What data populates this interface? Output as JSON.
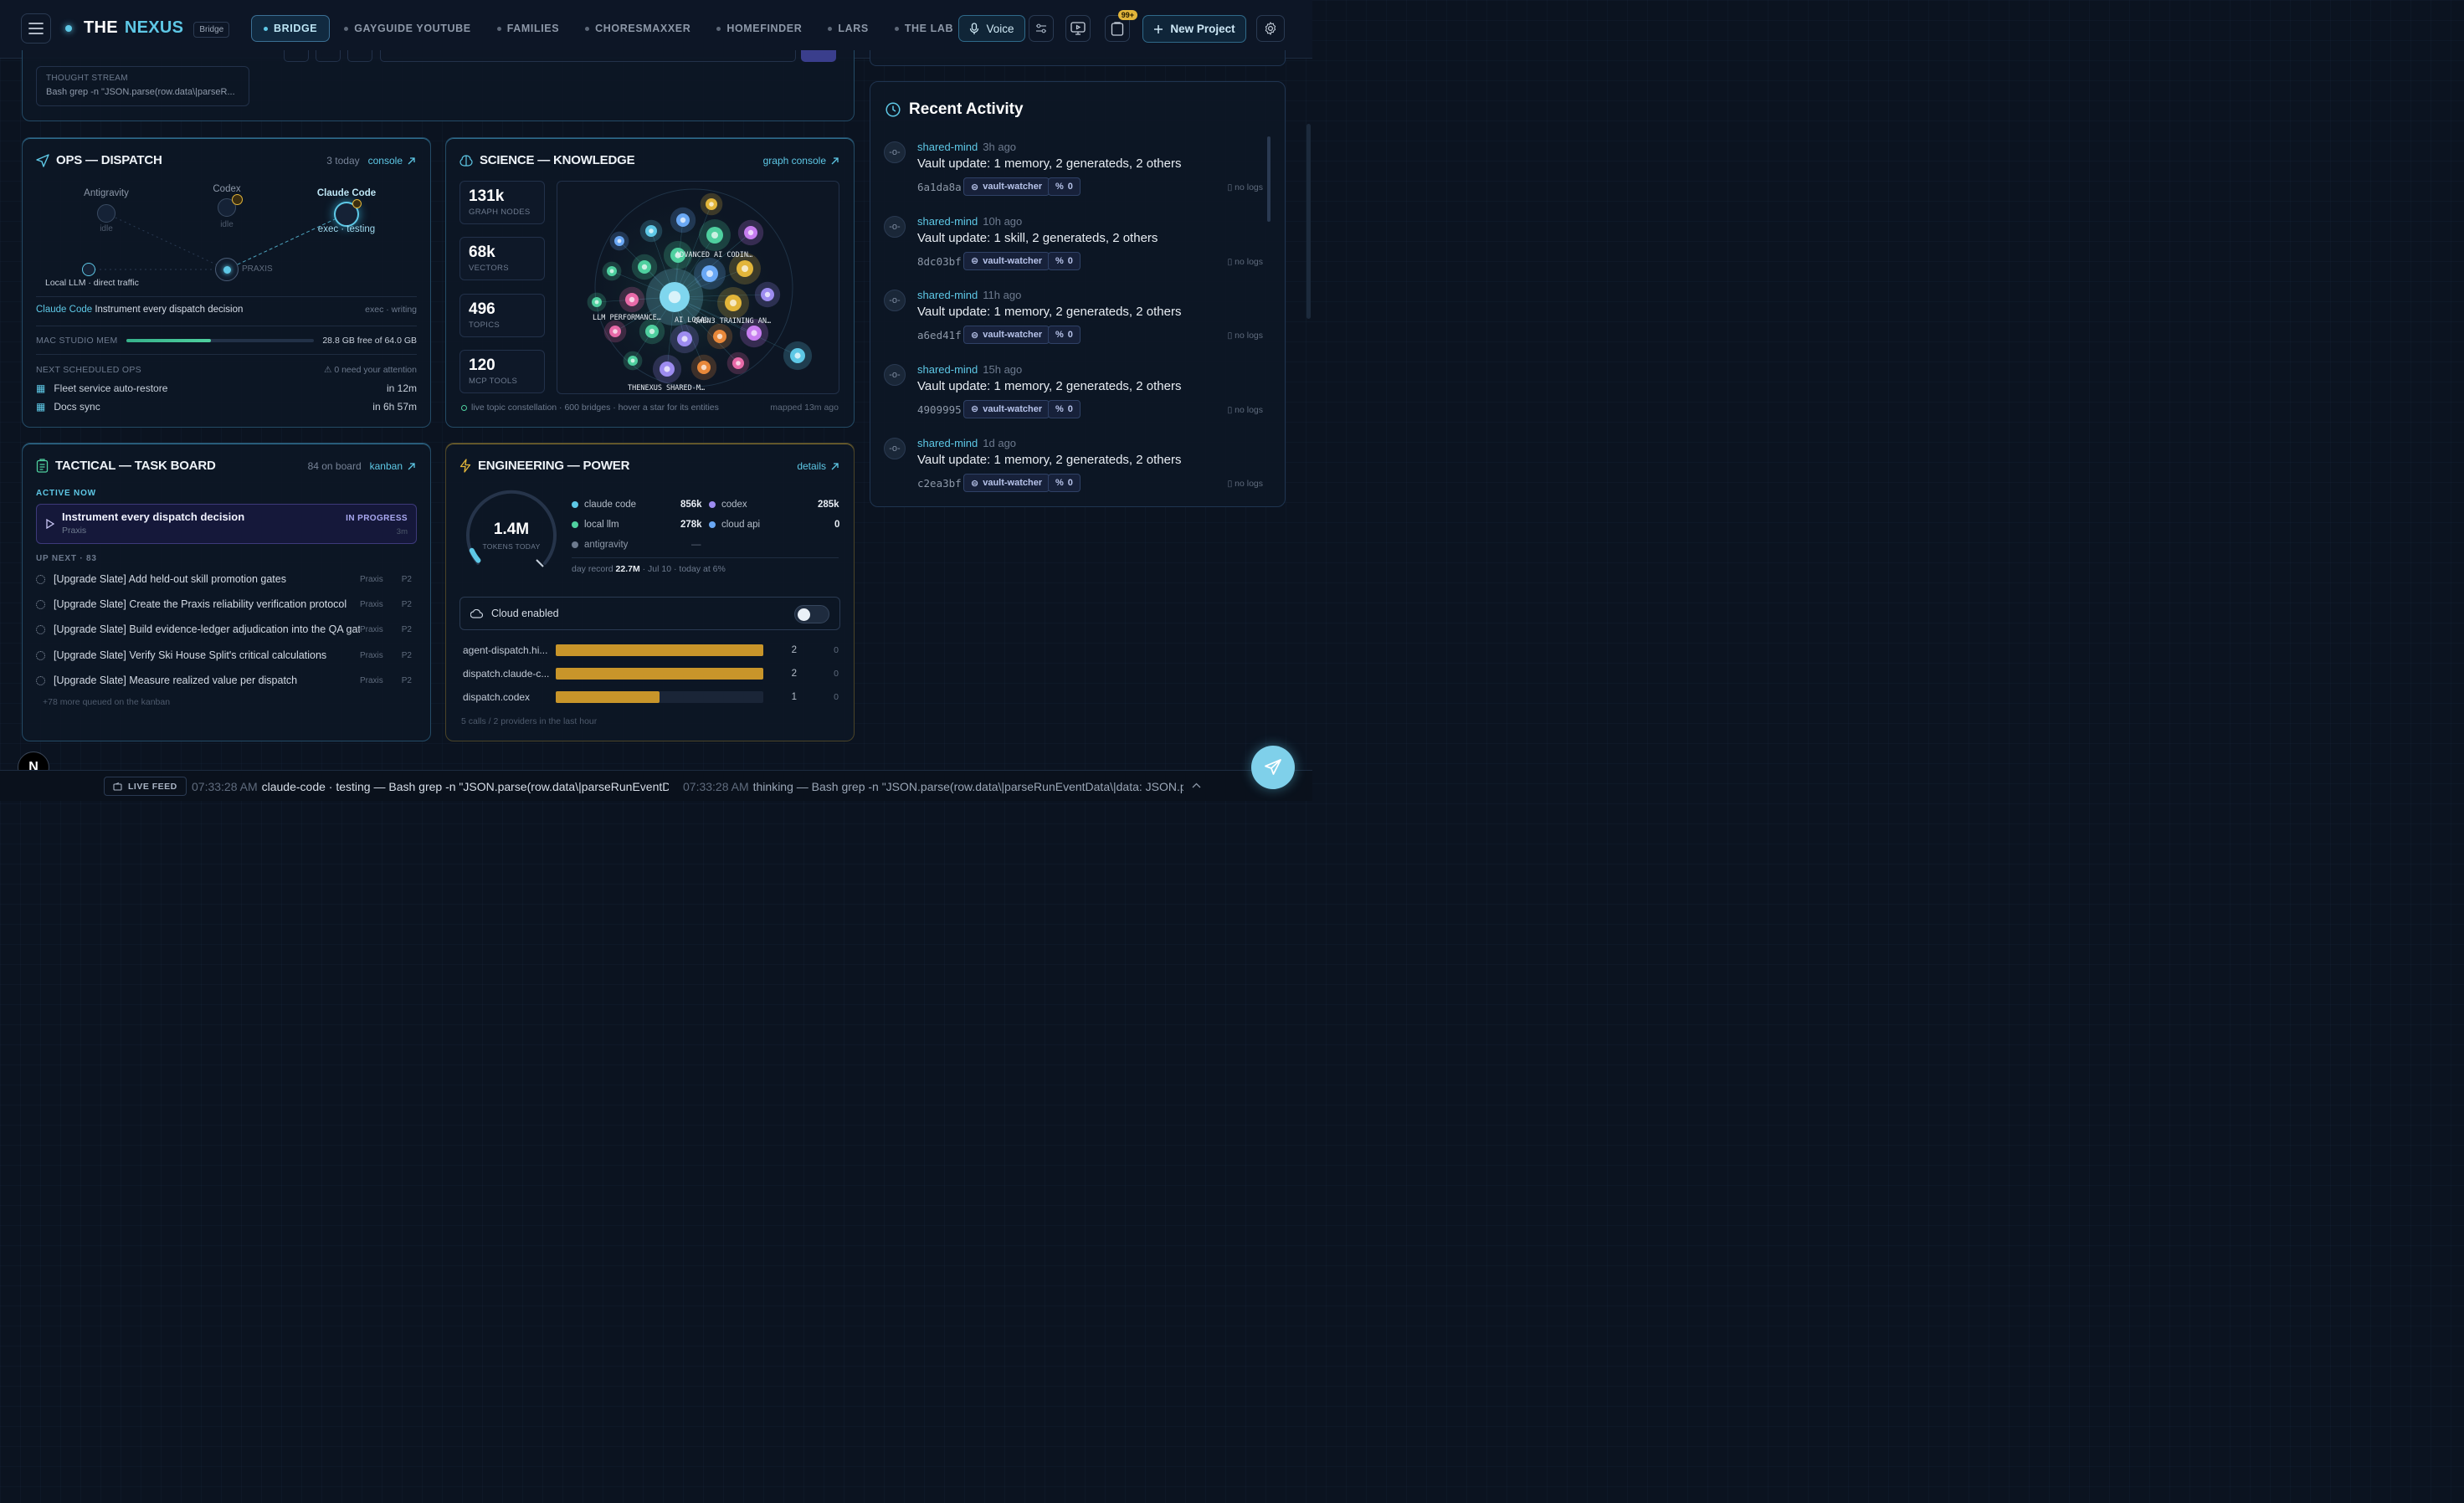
{
  "app": {
    "name_a": "THE",
    "name_b": "NEXUS",
    "tag": "Bridge"
  },
  "nav": {
    "tabs": [
      "BRIDGE",
      "GAYGUIDE YOUTUBE",
      "FAMILIES",
      "CHORESMAXXER",
      "HOMEFINDER",
      "LARS",
      "THE LAB"
    ]
  },
  "toolbar": {
    "voice": "Voice",
    "notifications_badge": "99+",
    "new_project": "New Project"
  },
  "thought_stream": {
    "label": "THOUGHT STREAM",
    "value": "Bash grep -n \"JSON.parse(row.data\\|parseR..."
  },
  "ops": {
    "title": "OPS — DISPATCH",
    "count": "3 today",
    "link": "console",
    "agents": {
      "antigravity": "Antigravity",
      "antigravity_status": "idle",
      "codex": "Codex",
      "codex_status": "idle",
      "claude": "Claude Code",
      "claude_status": "exec · testing",
      "praxis": "PRAXIS",
      "local": "Local LLM · direct traffic"
    },
    "current_agent": "Claude Code",
    "current_task": "Instrument every dispatch decision",
    "current_state": "exec · writing",
    "mem_label": "MAC STUDIO MEM",
    "mem_value": "28.8 GB free of 64.0 GB",
    "mem_used_fraction": 0.45,
    "scheduled_label": "NEXT SCHEDULED OPS",
    "attention": "0 need your attention",
    "scheduled": [
      {
        "name": "Fleet service auto-restore",
        "when": "in 12m"
      },
      {
        "name": "Docs sync",
        "when": "in 6h 57m"
      }
    ]
  },
  "science": {
    "title": "SCIENCE — KNOWLEDGE",
    "link": "graph console",
    "stats": [
      {
        "n": "131k",
        "l": "GRAPH NODES"
      },
      {
        "n": "68k",
        "l": "VECTORS"
      },
      {
        "n": "496",
        "l": "TOPICS"
      },
      {
        "n": "120",
        "l": "MCP TOOLS"
      }
    ],
    "graph_labels": [
      "ADVANCED AI CODIN…",
      "LLM PERFORMANCE…",
      "AI LOCAL",
      "QWEN3 TRAINING AN…",
      "THENEXUS SHARED-M…"
    ],
    "footer": "live topic constellation · 600 bridges · hover a star for its entities",
    "mapped": "mapped 13m ago"
  },
  "tactical": {
    "title": "TACTICAL — TASK BOARD",
    "count": "84 on board",
    "link": "kanban",
    "active_label": "ACTIVE NOW",
    "active": {
      "title": "Instrument every dispatch decision",
      "owner": "Praxis",
      "status": "IN PROGRESS",
      "age": "3m"
    },
    "next_label": "UP NEXT · 83",
    "tasks": [
      {
        "title": "[Upgrade Slate] Add held-out skill promotion gates",
        "owner": "Praxis",
        "p": "P2"
      },
      {
        "title": "[Upgrade Slate] Create the Praxis reliability verification protocol",
        "owner": "Praxis",
        "p": "P2"
      },
      {
        "title": "[Upgrade Slate] Build evidence-ledger adjudication into the QA gate",
        "owner": "Praxis",
        "p": "P2"
      },
      {
        "title": "[Upgrade Slate] Verify Ski House Split's critical calculations",
        "owner": "Praxis",
        "p": "P2"
      },
      {
        "title": "[Upgrade Slate] Measure realized value per dispatch",
        "owner": "Praxis",
        "p": "P2"
      }
    ],
    "more": "+78 more queued on the kanban"
  },
  "engineering": {
    "title": "ENGINEERING — POWER",
    "link": "details",
    "tokens": "1.4M",
    "tokens_label": "TOKENS TODAY",
    "today_fraction": 0.06,
    "legend": [
      {
        "name": "claude code",
        "value": "856k",
        "color": "#5ec8e6"
      },
      {
        "name": "codex",
        "value": "285k",
        "color": "#9d8cf0"
      },
      {
        "name": "local llm",
        "value": "278k",
        "color": "#4fd09f"
      },
      {
        "name": "cloud api",
        "value": "0",
        "color": "#6aa8f5"
      },
      {
        "name": "antigravity",
        "value": "—",
        "color": "#6d7a8e"
      }
    ],
    "record_prefix": "day record",
    "record_value": "22.7M",
    "record_suffix": "· Jul 10 · today at 6%",
    "cloud_label": "Cloud enabled",
    "cloud_enabled": false,
    "bars": [
      {
        "name": "agent-dispatch.hi...",
        "value": 2,
        "zero": "0"
      },
      {
        "name": "dispatch.claude-c...",
        "value": 2,
        "zero": "0"
      },
      {
        "name": "dispatch.codex",
        "value": 1,
        "zero": "0"
      }
    ],
    "bar_max": 2,
    "footer": "5 calls / 2 providers in the last hour"
  },
  "activity": {
    "title": "Recent Activity",
    "items": [
      {
        "who": "shared-mind",
        "when": "3h ago",
        "msg": "Vault update: 1 memory, 2 generateds, 2 others",
        "hash": "6a1da8a",
        "tag": "vault-watcher",
        "links": "0",
        "logs": "no logs"
      },
      {
        "who": "shared-mind",
        "when": "10h ago",
        "msg": "Vault update: 1 skill, 2 generateds, 2 others",
        "hash": "8dc03bf",
        "tag": "vault-watcher",
        "links": "0",
        "logs": "no logs"
      },
      {
        "who": "shared-mind",
        "when": "11h ago",
        "msg": "Vault update: 1 memory, 2 generateds, 2 others",
        "hash": "a6ed41f",
        "tag": "vault-watcher",
        "links": "0",
        "logs": "no logs"
      },
      {
        "who": "shared-mind",
        "when": "15h ago",
        "msg": "Vault update: 1 memory, 2 generateds, 2 others",
        "hash": "4909995",
        "tag": "vault-watcher",
        "links": "0",
        "logs": "no logs"
      },
      {
        "who": "shared-mind",
        "when": "1d ago",
        "msg": "Vault update: 1 memory, 2 generateds, 2 others",
        "hash": "c2ea3bf",
        "tag": "vault-watcher",
        "links": "0",
        "logs": "no logs"
      }
    ]
  },
  "feed": {
    "label": "LIVE FEED",
    "items": [
      {
        "ts": "07:33:28 AM",
        "text": "claude-code · testing — Bash grep -n \"JSON.parse(row.data\\|parseRunEventD..."
      },
      {
        "ts": "07:33:28 AM",
        "text": "thinking — Bash grep -n \"JSON.parse(row.data\\|parseRunEventData\\|data: JSON.pars"
      }
    ]
  },
  "fab_letter": "N",
  "colors": {
    "accent": "#5ec8e6",
    "gold": "#c8952a",
    "purple": "#9d8cf0",
    "green": "#4fd09f"
  }
}
